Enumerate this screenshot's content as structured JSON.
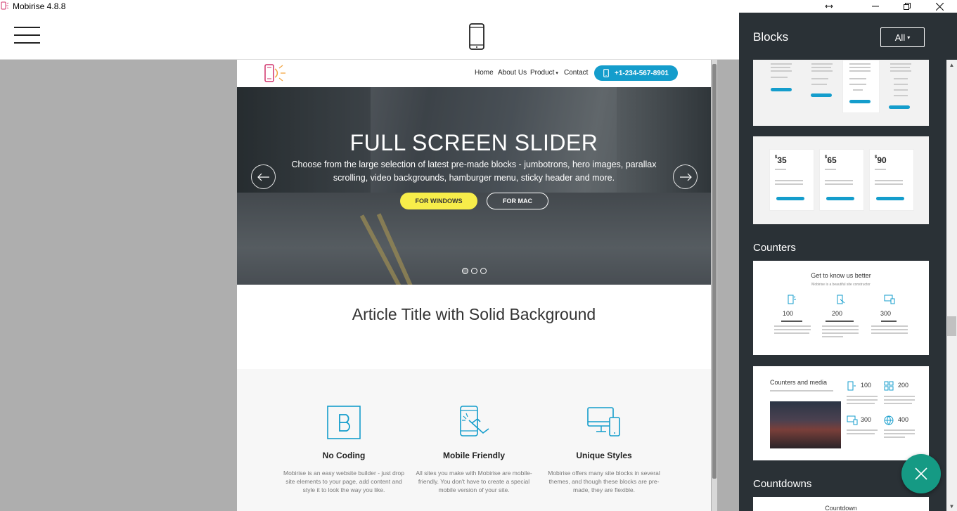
{
  "window": {
    "title": "Mobirise 4.8.8",
    "controls": [
      "resize-icon",
      "minimize-icon",
      "maximize-icon",
      "close-icon"
    ]
  },
  "toolbar": {
    "menu_icon": "hamburger-icon",
    "view_icon": "mobile-device-icon"
  },
  "site": {
    "nav": {
      "links": [
        "Home",
        "About Us",
        "Product",
        "Contact"
      ],
      "phone": "+1-234-567-8901"
    },
    "slider": {
      "title": "FULL SCREEN SLIDER",
      "description": "Choose from the large selection of latest pre-made blocks - jumbotrons, hero images, parallax scrolling, video backgrounds, hamburger menu, sticky header and more.",
      "button_windows": "FOR WINDOWS",
      "button_mac": "FOR MAC",
      "slides_count": 3,
      "active_slide": 1
    },
    "article": {
      "title": "Article Title with Solid Background"
    },
    "features": [
      {
        "icon": "bootstrap-icon",
        "title": "No Coding",
        "text": "Mobirise is an easy website builder - just drop site elements to your page, add content and style it to look the way you like."
      },
      {
        "icon": "touch-phone-icon",
        "title": "Mobile Friendly",
        "text": "All sites you make with Mobirise are mobile-friendly. You don't have to create a special mobile version of your site."
      },
      {
        "icon": "devices-icon",
        "title": "Unique Styles",
        "text": "Mobirise offers many site blocks in several themes, and though these blocks are pre-made, they are flexible."
      }
    ]
  },
  "panel": {
    "title": "Blocks",
    "filter": "All",
    "categories": [
      {
        "title": "Counters"
      },
      {
        "title": "Countdowns"
      }
    ],
    "pricing_thumb": {
      "prices": [
        "35",
        "65",
        "90"
      ],
      "currency": "$"
    },
    "counters_thumb1": {
      "title": "Get to know us better",
      "subtitle": "Mobirise is a beautiful site constructor",
      "numbers": [
        "100",
        "200",
        "300"
      ]
    },
    "counters_thumb2": {
      "title": "Counters and media",
      "numbers": [
        "100",
        "200",
        "300",
        "400"
      ]
    },
    "countdown_thumb": {
      "title": "Countdown"
    }
  },
  "colors": {
    "accent": "#149dcc",
    "yellow": "#f7ed4a",
    "panel_bg": "#2a3136",
    "fab": "#159a84"
  }
}
